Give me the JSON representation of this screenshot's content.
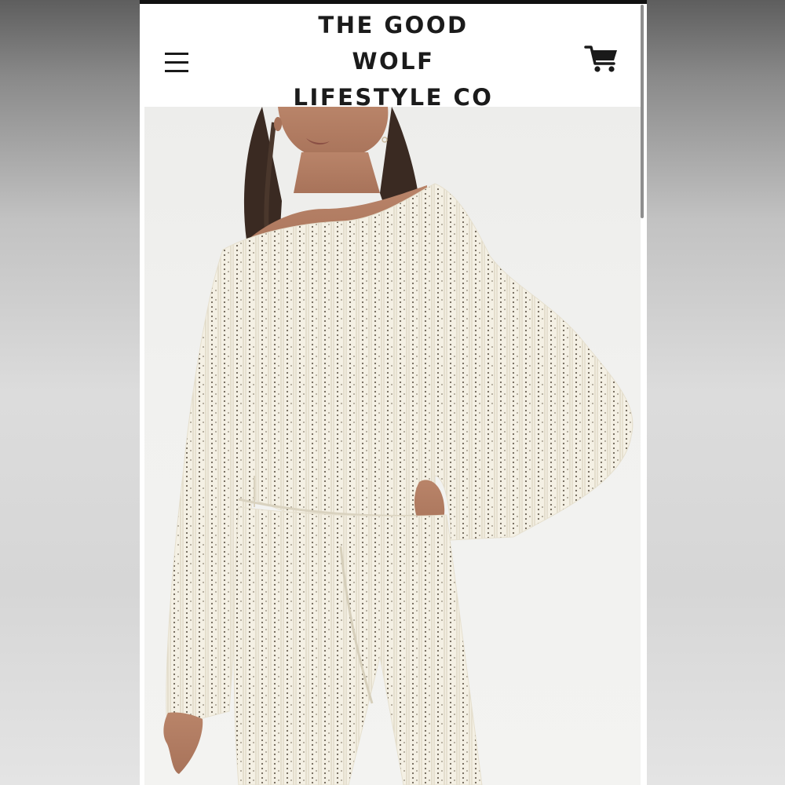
{
  "header": {
    "brand_lines": [
      "THE GOOD",
      "WOLF",
      "LIFESTYLE CO"
    ],
    "menu_icon": "hamburger-menu-icon",
    "cart_icon": "shopping-cart-icon"
  },
  "product_image": {
    "description_alt": "Model wearing cream open-knit long sleeve top and matching pants"
  },
  "colors": {
    "top_bar": "#111111",
    "text": "#1b1b1b",
    "garment": "#f4f0e4",
    "background": "#f1f1ef"
  }
}
